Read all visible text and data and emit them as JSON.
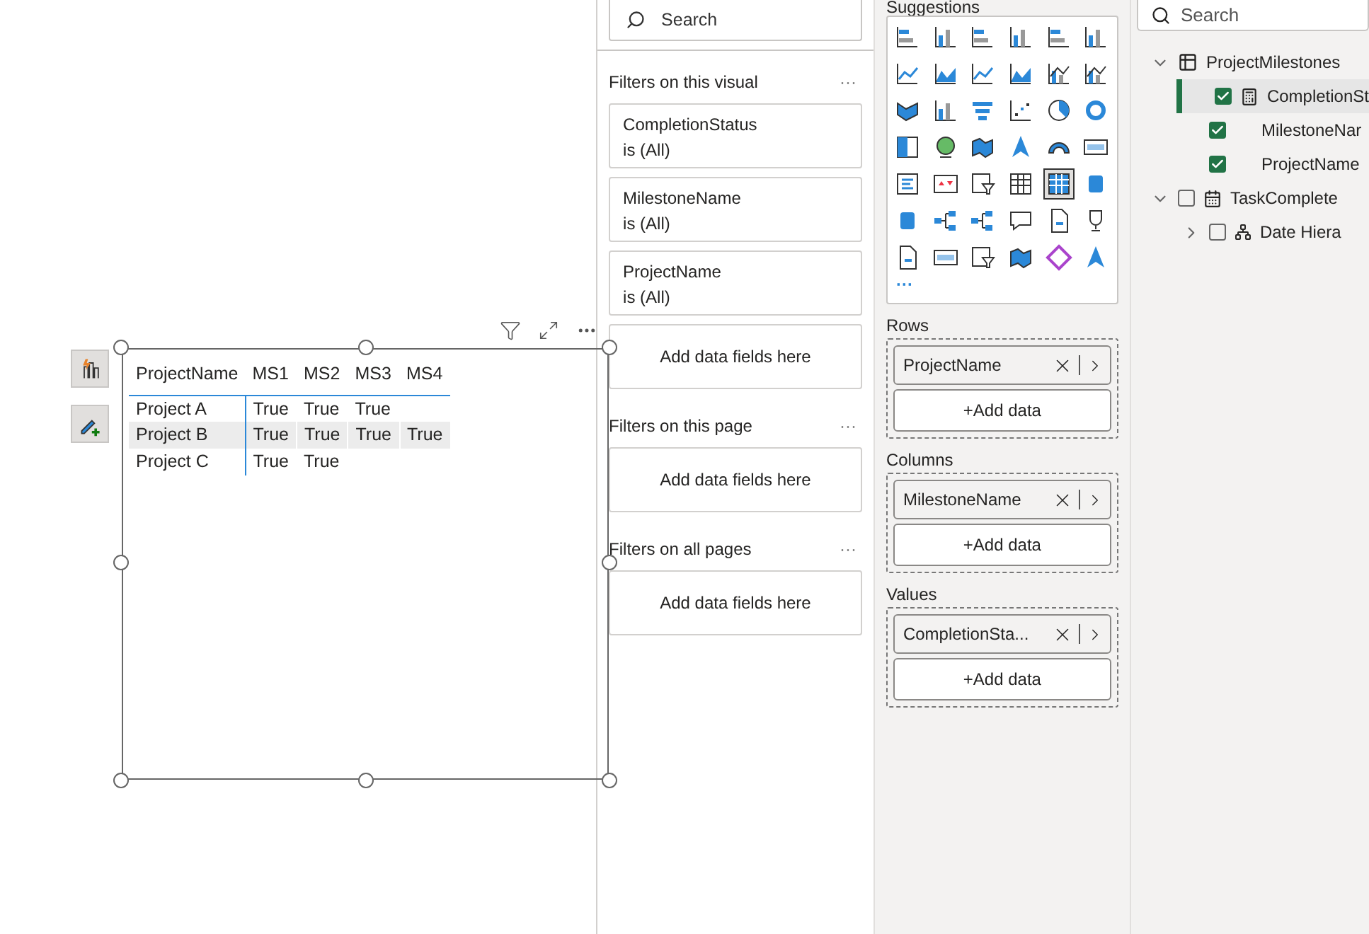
{
  "visual": {
    "columns": [
      "ProjectName",
      "MS1",
      "MS2",
      "MS3",
      "MS4"
    ],
    "rows": [
      {
        "cells": [
          "Project A",
          "True",
          "True",
          "True",
          ""
        ],
        "selected": false
      },
      {
        "cells": [
          "Project B",
          "True",
          "True",
          "True",
          "True"
        ],
        "selected": true
      },
      {
        "cells": [
          "Project C",
          "True",
          "True",
          "",
          ""
        ],
        "selected": false
      }
    ]
  },
  "filters": {
    "search": {
      "placeholder": "Search"
    },
    "sections": [
      {
        "title": "Filters on this visual",
        "menu": "···",
        "cards": [
          {
            "field": "CompletionStatus",
            "value": "is (All)"
          },
          {
            "field": "MilestoneName",
            "value": "is (All)"
          },
          {
            "field": "ProjectName",
            "value": "is (All)"
          }
        ],
        "drop": "Add data fields here"
      },
      {
        "title": "Filters on this page",
        "menu": "···",
        "drop": "Add data fields here"
      },
      {
        "title": "Filters on all pages",
        "menu": "···",
        "drop": "Add data fields here"
      }
    ]
  },
  "visualizations": {
    "title": "Suggestions",
    "more": "···",
    "wells": [
      {
        "title": "Rows",
        "field": "ProjectName",
        "add": "+Add data"
      },
      {
        "title": "Columns",
        "field": "MilestoneName",
        "add": "+Add data"
      },
      {
        "title": "Values",
        "field": "CompletionSta...",
        "add": "+Add data"
      }
    ]
  },
  "fields": {
    "search": {
      "placeholder": "Search"
    },
    "tree": [
      {
        "label": "ProjectMilestones",
        "kind": "table",
        "expanded": true,
        "checked": false,
        "children": [
          {
            "label": "CompletionSt",
            "kind": "measure",
            "checked": true,
            "selected": true
          },
          {
            "label": "MilestoneNar",
            "kind": "field",
            "checked": true,
            "selected": false
          },
          {
            "label": "ProjectName",
            "kind": "field",
            "checked": true,
            "selected": false
          }
        ]
      },
      {
        "label": "TaskComplete",
        "kind": "calendar",
        "expanded": true,
        "checked": false,
        "children": [
          {
            "label": "Date Hiera",
            "kind": "hierarchy",
            "expanded": false,
            "checked": false,
            "selected": false
          }
        ]
      }
    ]
  }
}
